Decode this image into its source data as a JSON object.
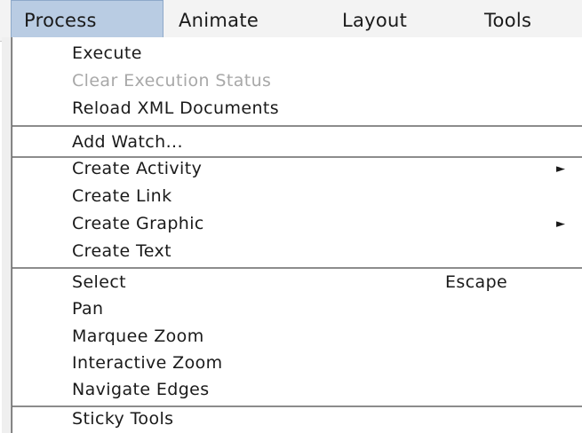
{
  "menubar": {
    "titles": [
      "Process",
      "Animate",
      "Layout",
      "Tools"
    ],
    "active": "Process"
  },
  "menu": {
    "items": [
      {
        "label": "Execute",
        "enabled": true
      },
      {
        "label": "Clear Execution Status",
        "enabled": false
      },
      {
        "label": "Reload XML Documents",
        "enabled": true
      },
      {
        "label": "Add Watch...",
        "enabled": true
      },
      {
        "label": "Create Activity",
        "enabled": true,
        "submenu": true,
        "arrow": "►"
      },
      {
        "label": "Create Link",
        "enabled": true
      },
      {
        "label": "Create Graphic",
        "enabled": true,
        "submenu": true,
        "arrow": "►"
      },
      {
        "label": "Create Text",
        "enabled": true
      },
      {
        "label": "Select",
        "enabled": true,
        "accelerator": "Escape"
      },
      {
        "label": "Pan",
        "enabled": true
      },
      {
        "label": "Marquee Zoom",
        "enabled": true
      },
      {
        "label": "Interactive Zoom",
        "enabled": true
      },
      {
        "label": "Navigate Edges",
        "enabled": true
      },
      {
        "label": "Sticky Tools",
        "enabled": true
      }
    ]
  },
  "colors": {
    "menu_highlight": "#b9cce3",
    "disabled_text": "#a8a8a8",
    "text": "#1a1a1a"
  }
}
